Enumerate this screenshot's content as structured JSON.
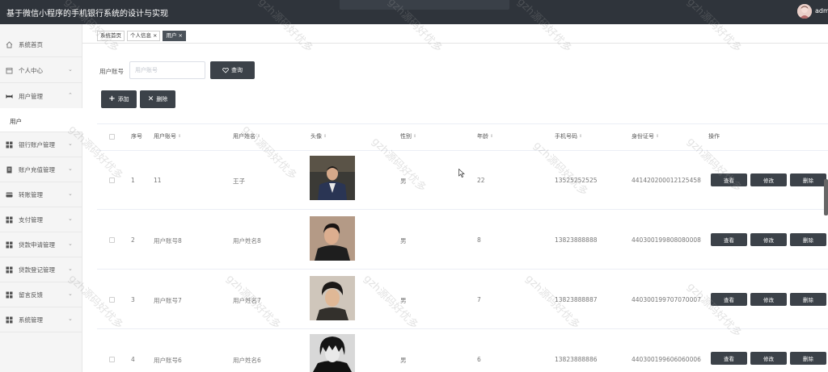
{
  "header": {
    "title": "基于微信小程序的手机银行系统的设计与实现",
    "user_name": "adm"
  },
  "sidebar": {
    "items": [
      {
        "label": "系统首页",
        "icon": "home-icon"
      },
      {
        "label": "个人中心",
        "icon": "calendar-icon"
      },
      {
        "label": "用户管理",
        "icon": "user-group-icon",
        "expanded": true
      },
      {
        "label": "银行账户管理",
        "icon": "grid-icon"
      },
      {
        "label": "账户充值管理",
        "icon": "document-icon"
      },
      {
        "label": "转账管理",
        "icon": "card-icon"
      },
      {
        "label": "支付管理",
        "icon": "grid-icon"
      },
      {
        "label": "贷款申请管理",
        "icon": "grid-icon"
      },
      {
        "label": "贷款登记管理",
        "icon": "grid-icon"
      },
      {
        "label": "留言反馈",
        "icon": "grid-icon"
      },
      {
        "label": "系统管理",
        "icon": "grid-icon"
      }
    ],
    "sub_item": "用户"
  },
  "tabs": [
    {
      "label": "系统首页",
      "closable": false
    },
    {
      "label": "个人信息",
      "closable": true
    },
    {
      "label": "用户",
      "closable": true,
      "active": true
    }
  ],
  "search": {
    "label": "用户账号",
    "placeholder": "用户账号",
    "button": "查询"
  },
  "toolbar": {
    "add": "添加",
    "delete": "删除"
  },
  "table": {
    "headers": [
      "序号",
      "用户账号",
      "用户姓名",
      "头像",
      "性别",
      "年龄",
      "手机号码",
      "身份证号",
      "操作"
    ],
    "rows": [
      {
        "index": "1",
        "account": "11",
        "name": "王子",
        "gender": "男",
        "age": "22",
        "phone": "13525252525",
        "id_card": "441420200012125458"
      },
      {
        "index": "2",
        "account": "用户账号8",
        "name": "用户姓名8",
        "gender": "男",
        "age": "8",
        "phone": "13823888888",
        "id_card": "440300199808080008"
      },
      {
        "index": "3",
        "account": "用户账号7",
        "name": "用户姓名7",
        "gender": "男",
        "age": "7",
        "phone": "13823888887",
        "id_card": "440300199707070007"
      },
      {
        "index": "4",
        "account": "用户账号6",
        "name": "用户姓名6",
        "gender": "男",
        "age": "6",
        "phone": "13823888886",
        "id_card": "440300199606060006"
      }
    ],
    "actions": {
      "view": "查看",
      "edit": "修改",
      "delete": "删除"
    }
  },
  "watermark": "gzh源码好优多"
}
